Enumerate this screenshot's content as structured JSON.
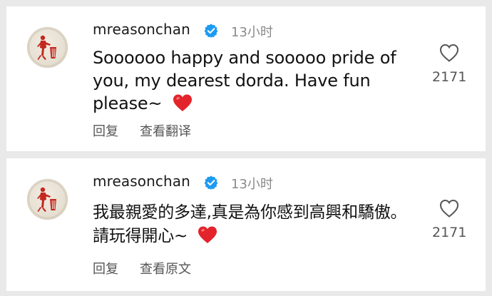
{
  "comments": [
    {
      "username": "mreasonchan",
      "time": "13小时",
      "text": "Soooooo happy and sooooo pride of you, my dearest dorda. Have fun please~",
      "likes": "2171",
      "reply_label": "回复",
      "secondary_label": "查看翻译"
    },
    {
      "username": "mreasonchan",
      "time": "13小时",
      "text": "我最親愛的多達,真是為你感到高興和驕傲。 請玩得開心~",
      "likes": "2171",
      "reply_label": "回复",
      "secondary_label": "查看原文"
    }
  ],
  "colors": {
    "background": "#e9e9e9",
    "card": "#ffffff",
    "verified_badge": "#1d9bf0",
    "heart_emoji": "#e3242b",
    "secondary_text": "#8a8a8a"
  },
  "icons": {
    "verified": "verified-badge-icon",
    "like": "heart-outline-icon",
    "emoji": "red-heart-emoji"
  }
}
